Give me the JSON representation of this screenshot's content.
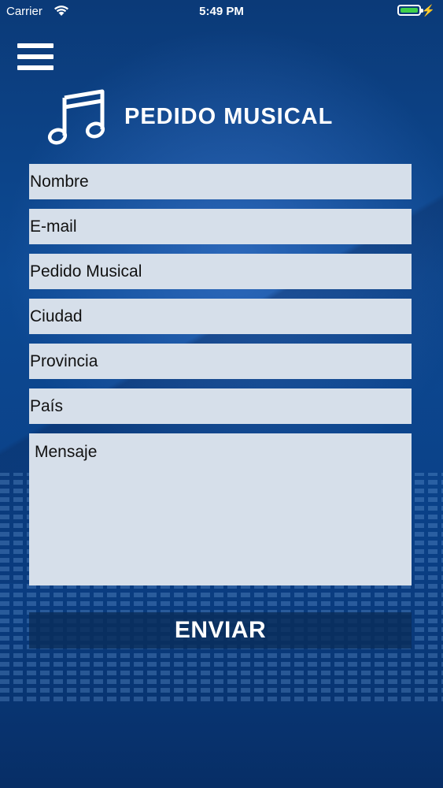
{
  "status_bar": {
    "carrier": "Carrier",
    "time": "5:49 PM",
    "battery_color": "#3ed14a"
  },
  "header": {
    "menu_icon": "hamburger-menu-icon",
    "logo_icon": "music-note-icon",
    "logo_text": "PEDIDO MUSICAL"
  },
  "form": {
    "name_placeholder": "Nombre",
    "email_placeholder": "E-mail",
    "request_placeholder": "Pedido Musical",
    "city_placeholder": "Ciudad",
    "province_placeholder": "Provincia",
    "country_placeholder": "País",
    "message_placeholder": "Mensaje",
    "submit_label": "ENVIAR"
  },
  "colors": {
    "background": "#0d4a94",
    "field_background": "#d6dfea",
    "button_background": "#0a2d5a",
    "text_light": "#ffffff"
  }
}
